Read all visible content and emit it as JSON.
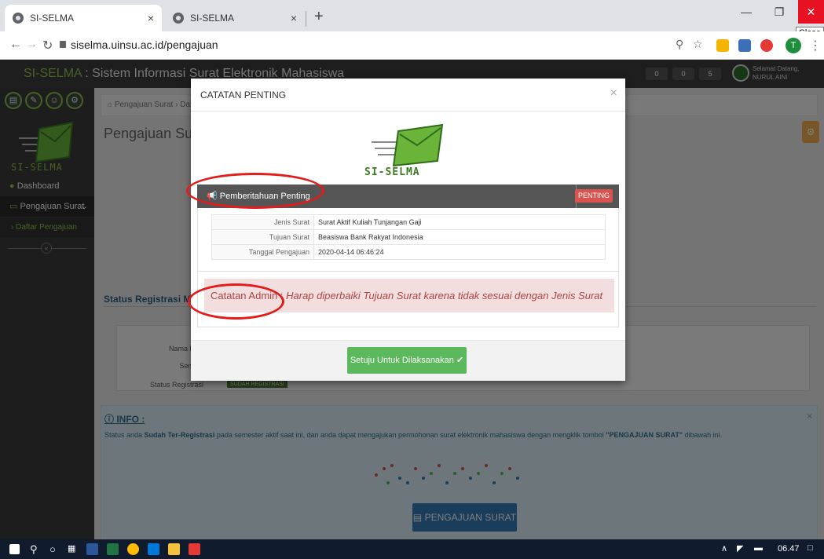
{
  "browser": {
    "tabs": [
      {
        "label": "SI-SELMA",
        "close": "×"
      },
      {
        "label": "SI-SELMA",
        "close": "×"
      }
    ],
    "new_tab": "+",
    "url": "siselma.uinsu.ac.id/pengajuan",
    "profile_initial": "T",
    "tooltip_close": "Close"
  },
  "app": {
    "title_brand": "SI-SELMA",
    "title_rest": " : Sistem Informasi Surat Elektronik Mahasiswa",
    "badges": [
      "0",
      "0",
      "5"
    ],
    "greeting_line1": "Selamat Datang,",
    "greeting_line2": "NURUL AINI"
  },
  "sidebar": {
    "logo_text": "SI-SELMA",
    "items": [
      {
        "label": "Dashboard"
      },
      {
        "label": "Pengajuan Surat"
      }
    ],
    "sub_items": [
      {
        "label": "Daftar Pengajuan"
      }
    ]
  },
  "main": {
    "breadcrumb": "Pengajuan Surat › Dafta",
    "page_title": "Pengajuan Surat",
    "status_heading": "Status Registrasi Maha",
    "status_rows": [
      {
        "label": "Nama Mah"
      },
      {
        "label": "Semest"
      },
      {
        "label": "Status Registrasi"
      }
    ],
    "status_badge": "SUDAH REGISTRASI",
    "info_heading": "INFO :",
    "info_text_1": "Status anda ",
    "info_text_bold": "Sudah Ter-Registrasi",
    "info_text_2": " pada semester aktif saat ini, dan anda dapat mengajukan permohonan surat elektronik mahasiswa dengan mengklik tombol ",
    "info_text_btn": "\"PENGAJUAN SURAT\"",
    "info_text_3": " dibawah ini.",
    "pengajuan_button": "PENGAJUAN SURAT"
  },
  "modal": {
    "title": "CATATAN PENTING",
    "close": "×",
    "logo_text": "SI-SELMA",
    "panel_title": "Pemberitahuan Penting",
    "panel_badge": "PENTING",
    "rows": [
      {
        "key": "Jenis Surat",
        "value": "Surat Aktif Kuliah Tunjangan Gaji"
      },
      {
        "key": "Tujuan Surat",
        "value": "Beasiswa Bank Rakyat Indonesia"
      },
      {
        "key": "Tanggal Pengajuan",
        "value": "2020-04-14 06:46:24"
      }
    ],
    "note_label": "Catatan Admin : ",
    "note_text": "Harap diperbaiki Tujuan Surat karena tidak sesuai dengan Jenis Surat",
    "agree_button": "Setuju Untuk Dilaksanakan"
  },
  "taskbar": {
    "clock": "06.47"
  },
  "colors": {
    "accent_green": "#8bc34a",
    "header_dark": "#3d3d3d",
    "danger": "#d9534f",
    "success": "#5cb85c",
    "primary": "#337ab7",
    "annotation_red": "#e21b1b"
  }
}
